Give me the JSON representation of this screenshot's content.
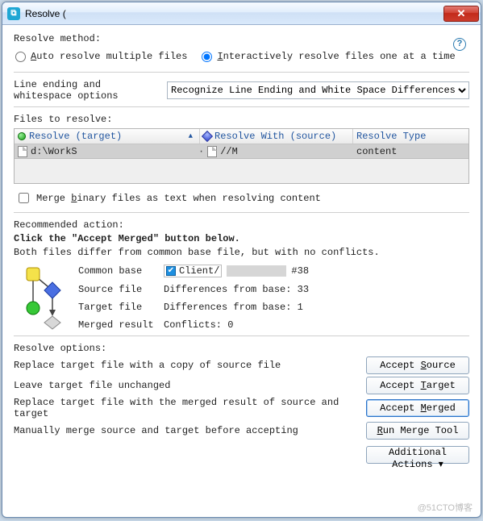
{
  "window": {
    "title": "Resolve ("
  },
  "labels": {
    "resolve_method": "Resolve method:",
    "auto_resolve": "Auto resolve multiple files",
    "interactive": "Interactively resolve files one at a time",
    "line_ending_label": "Line ending and whitespace options",
    "line_ending_value": "Recognize Line Ending and White Space Differences",
    "files_to_resolve": "Files to resolve:",
    "col_target": "Resolve (target)",
    "col_source": "Resolve With (source)",
    "col_type": "Resolve Type",
    "merge_binary": "Merge binary files as text when resolving content",
    "recommended": "Recommended action:",
    "rec_bold": "Click the \"Accept Merged\" button below.",
    "rec_expl": "Both files differ from common base file, but with no conflicts.",
    "common_base": "Common base",
    "source_file": "Source file",
    "target_file": "Target file",
    "merged_result": "Merged result",
    "client_prefix": "Client/",
    "rev_suffix": "#38",
    "diff_source": "Differences from base: 33",
    "diff_target": "Differences from base: 1",
    "conflicts": "Conflicts: 0",
    "resolve_options": "Resolve options:",
    "opt_source": "Replace target file with a copy of source file",
    "opt_target": "Leave target file unchanged",
    "opt_merged": "Replace target file with the merged result of source and target",
    "opt_tool": "Manually merge source and target before accepting"
  },
  "row": {
    "target_path": "d:\\WorkS",
    "source_path": "//M",
    "type": "content"
  },
  "buttons": {
    "accept_source": "Accept Source",
    "accept_target": "Accept Target",
    "accept_merged": "Accept Merged",
    "run_tool": "Run Merge Tool",
    "additional": "Additional Actions"
  },
  "watermark": "@51CTO博客"
}
